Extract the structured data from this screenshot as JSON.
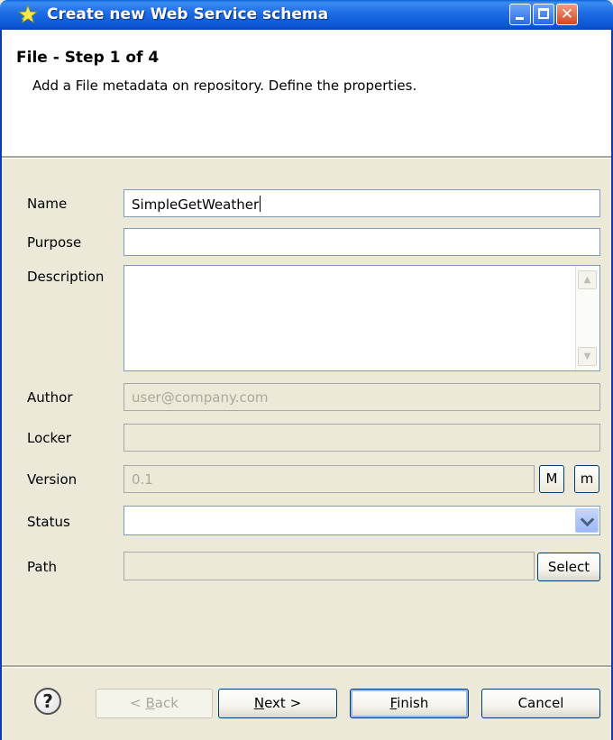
{
  "window": {
    "title": "Create new Web Service schema",
    "icon": "star-wizard-icon",
    "controls": [
      "minimize-icon",
      "maximize-icon",
      "close-icon"
    ]
  },
  "header": {
    "step_title": "File - Step 1 of 4",
    "description": "Add a File metadata on repository. Define the properties."
  },
  "form": {
    "name": {
      "label": "Name",
      "value": "SimpleGetWeather"
    },
    "purpose": {
      "label": "Purpose",
      "value": ""
    },
    "description": {
      "label": "Description",
      "value": ""
    },
    "author": {
      "label": "Author",
      "value": "user@company.com"
    },
    "locker": {
      "label": "Locker",
      "value": ""
    },
    "version": {
      "label": "Version",
      "value": "0.1",
      "major_label": "M",
      "minor_label": "m"
    },
    "status": {
      "label": "Status",
      "value": ""
    },
    "path": {
      "label": "Path",
      "value": "",
      "select_label": "Select"
    }
  },
  "footer": {
    "help": "?",
    "back_prefix": "< ",
    "back_key": "B",
    "back_rest": "ack",
    "next_key": "N",
    "next_rest": "ext >",
    "finish_key": "F",
    "finish_rest": "inish",
    "cancel_label": "Cancel"
  },
  "colors": {
    "titlebar": "#0b55d4",
    "dialog_bg": "#ece9d8",
    "field_border": "#7f9db9",
    "close_button": "#d6451f"
  }
}
